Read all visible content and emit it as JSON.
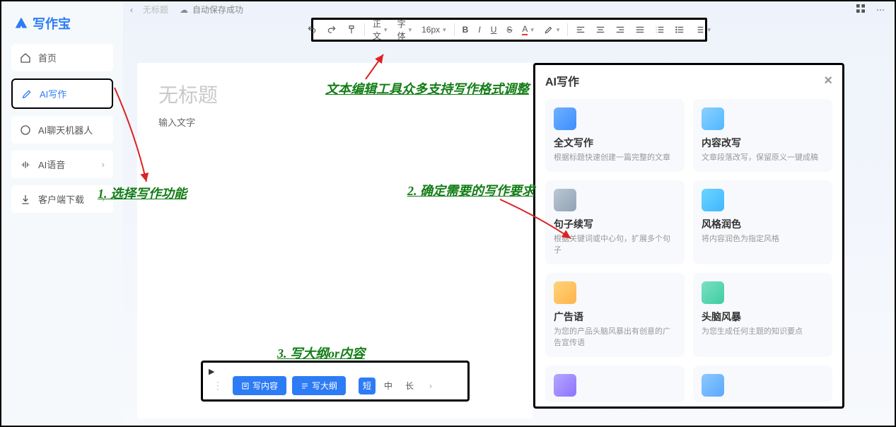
{
  "app": {
    "name": "写作宝"
  },
  "sidebar": {
    "items": [
      {
        "label": "首页"
      },
      {
        "label": "AI写作"
      },
      {
        "label": "AI聊天机器人"
      },
      {
        "label": "AI语音"
      },
      {
        "label": "客户端下载"
      }
    ]
  },
  "topbar": {
    "tab": "无标题",
    "autosave": "自动保存成功"
  },
  "toolbar": {
    "font_label": "正文",
    "family_label": "字体",
    "size_label": "16px"
  },
  "editor": {
    "title_placeholder": "无标题",
    "body_placeholder": "输入文字"
  },
  "bottombar": {
    "write_content": "写内容",
    "write_outline": "写大纲",
    "len_short": "短",
    "len_mid": "中",
    "len_long": "长"
  },
  "ai": {
    "title": "AI写作",
    "cards": [
      {
        "title": "全文写作",
        "desc": "根据标题快速创建一篇完整的文章"
      },
      {
        "title": "内容改写",
        "desc": "文章段落改写，保留原义一键成稿"
      },
      {
        "title": "句子续写",
        "desc": "根据关键词或中心句，扩展多个句子"
      },
      {
        "title": "风格润色",
        "desc": "将内容润色为指定风格"
      },
      {
        "title": "广告语",
        "desc": "为您的产品头脑风暴出有创意的广告宣传语"
      },
      {
        "title": "头脑风暴",
        "desc": "为您生成任何主题的知识要点"
      }
    ]
  },
  "annotations": {
    "a1": "1. 选择写作功能",
    "a2": "2. 确定需要的写作要求",
    "a3": "3. 写大纲or内容",
    "a_top": "文本编辑工具众多支持写作格式调整"
  }
}
